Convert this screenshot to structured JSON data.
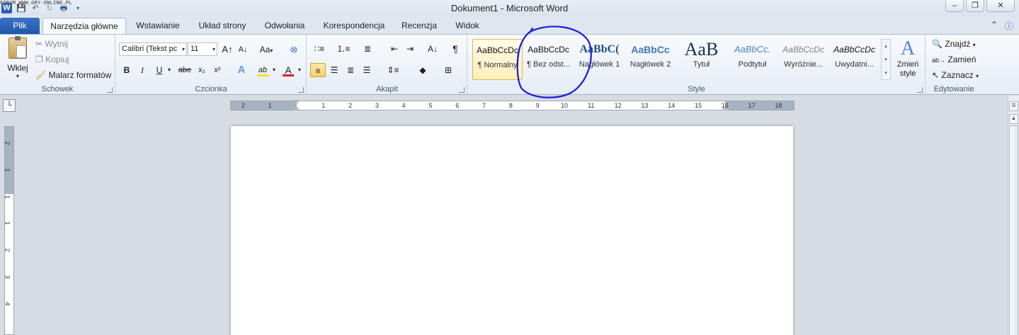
{
  "watermark": "FORUM WWW.GRY-ONLINE.PL",
  "window": {
    "title": "Dokument1  -  Microsoft Word",
    "qat_icons": [
      "word-logo",
      "save-icon",
      "undo-icon",
      "redo-icon",
      "print-preview-icon",
      "customize-qat-icon"
    ]
  },
  "tabs": [
    {
      "label": "Plik"
    },
    {
      "label": "Narzędzia główne"
    },
    {
      "label": "Wstawianie"
    },
    {
      "label": "Układ strony"
    },
    {
      "label": "Odwołania"
    },
    {
      "label": "Korespondencja"
    },
    {
      "label": "Recenzja"
    },
    {
      "label": "Widok"
    }
  ],
  "clipboard": {
    "label": "Schowek",
    "paste": "Wklej",
    "cut": "Wytnij",
    "copy": "Kopiuj",
    "format_painter": "Malarz formatów"
  },
  "font": {
    "label": "Czcionka",
    "family": "Calibri (Tekst pc",
    "size": "11",
    "change_case": "Aa",
    "bold": "B",
    "italic": "I",
    "underline": "U",
    "strike": "abe",
    "subscript": "x₂",
    "superscript": "x²",
    "effects": "A",
    "highlight": "ab",
    "color": "A",
    "color_hex": "#e01e1e",
    "highlight_hex": "#f5e400"
  },
  "paragraph": {
    "label": "Akapit",
    "pilcrow": "¶"
  },
  "styles": {
    "label": "Style",
    "items": [
      {
        "sample": "AaBbCcDc",
        "name": "¶ Normalny"
      },
      {
        "sample": "AaBbCcDc",
        "name": "¶ Bez odst..."
      },
      {
        "sample": "AaBbC(",
        "name": "Nagłówek 1"
      },
      {
        "sample": "AaBbCc",
        "name": "Nagłówek 2"
      },
      {
        "sample": "AaB",
        "name": "Tytuł"
      },
      {
        "sample": "AaBbCc.",
        "name": "Podtytuł"
      },
      {
        "sample": "AaBbCcDc",
        "name": "Wyróżnie..."
      },
      {
        "sample": "AaBbCcDc",
        "name": "Uwydatni..."
      }
    ],
    "change_styles": "Zmień style"
  },
  "editing": {
    "label": "Edytowanie",
    "find": "Znajdź",
    "replace": "Zamień",
    "select": "Zaznacz"
  },
  "ruler": {
    "labels": [
      "2",
      "1",
      "1",
      "1",
      "2",
      "3",
      "4",
      "5",
      "6",
      "7",
      "8",
      "9",
      "10",
      "11",
      "12",
      "13",
      "14",
      "15",
      "16",
      "17",
      "18"
    ],
    "vlabels": [
      "2",
      "1",
      "1",
      "1",
      "2",
      "3",
      "4"
    ]
  },
  "annotation_color": "#1a1adc"
}
